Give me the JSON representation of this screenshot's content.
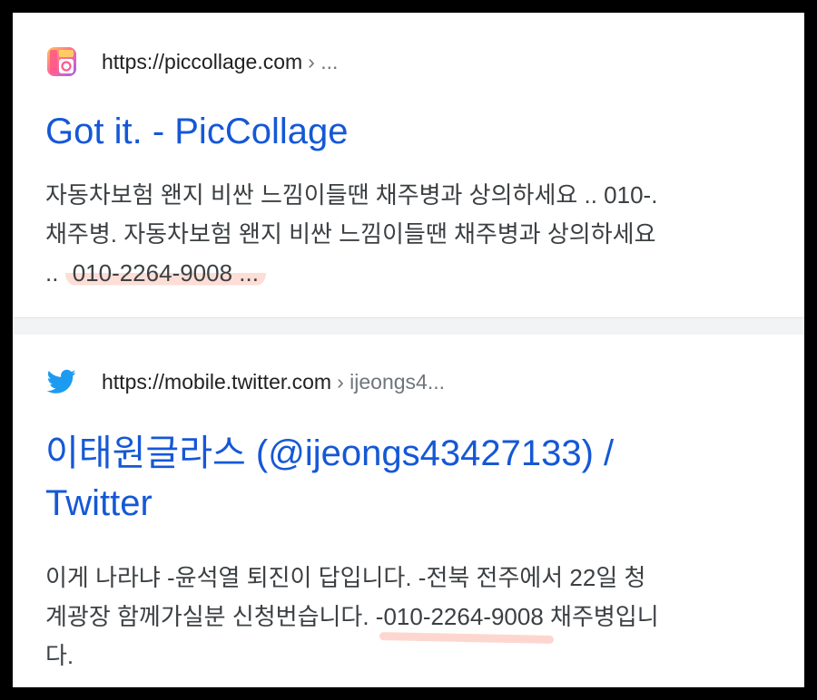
{
  "results": [
    {
      "favicon": "piccollage-icon",
      "url": "https://piccollage.com",
      "path": "› ...",
      "title": "Got it. - PicCollage",
      "snippet_line1": "자동차보험 왠지 비싼 느낌이들땐 채주병과 상의하세요 .. 010-.",
      "snippet_line2": "채주병. 자동차보험 왠지 비싼 느낌이들땐 채주병과 상의하세요",
      "snippet_line3_prefix": "..",
      "snippet_line3_highlight": "010-2264-9008 ..."
    },
    {
      "favicon": "twitter-bird-icon",
      "url": "https://mobile.twitter.com",
      "path": "› ijeongs4...",
      "title_line1": "이태원글라스 (@ijeongs43427133) /",
      "title_line2": "Twitter",
      "snippet_line1": "이게 나라냐 -윤석열 퇴진이 답입니다. -전북 전주에서 22일 청",
      "snippet_line2_prefix": "계광장 함께가실분 신청번습니다. -",
      "snippet_line2_highlight": "010-2264-9008",
      "snippet_line2_suffix": " 채주병입니",
      "snippet_line3": "다."
    }
  ],
  "colors": {
    "title": "#1558d6",
    "snippet": "#3c4043",
    "highlight": "#fcd2c8",
    "twitter": "#1d9bf0"
  }
}
